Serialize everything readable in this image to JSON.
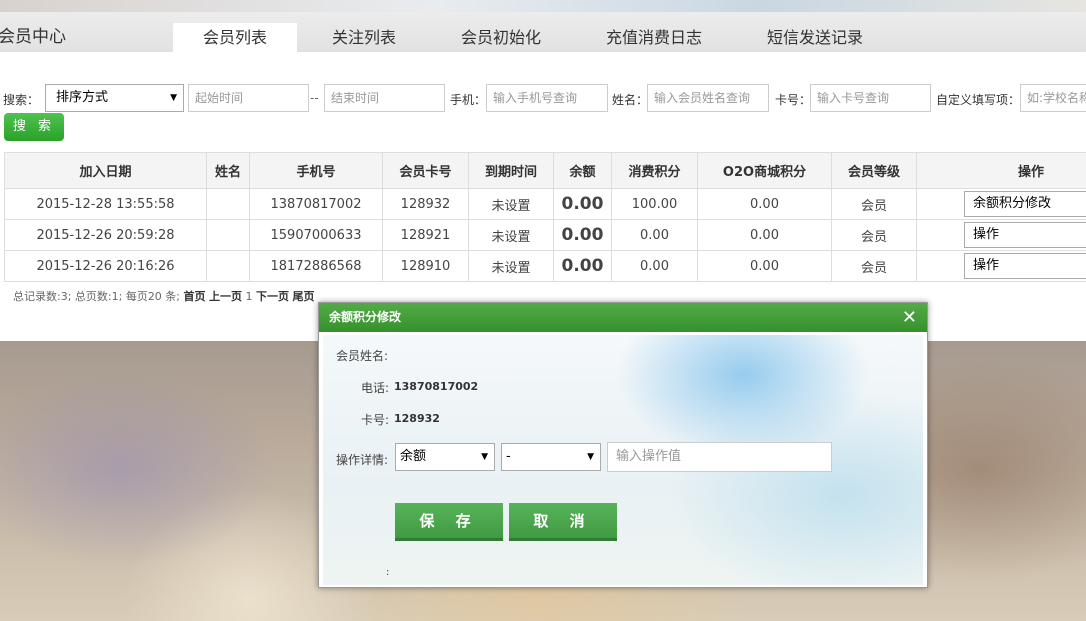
{
  "header": {
    "title": "会员中心",
    "tabs": [
      {
        "label": "会员列表",
        "active": true
      },
      {
        "label": "关注列表",
        "active": false
      },
      {
        "label": "会员初始化",
        "active": false
      },
      {
        "label": "充值消费日志",
        "active": false
      },
      {
        "label": "短信发送记录",
        "active": false
      }
    ]
  },
  "search": {
    "label": "搜索：",
    "sort_value": "排序方式",
    "start_placeholder": "起始时间",
    "separator": "--",
    "end_placeholder": "结束时间",
    "phone_label": "手机：",
    "phone_placeholder": "输入手机号查询",
    "name_label": "姓名：",
    "name_placeholder": "输入会员姓名查询",
    "card_label": "卡号：",
    "card_placeholder": "输入卡号查询",
    "custom_label": "自定义填写项：",
    "custom_placeholder": "如:学校名称",
    "button": "搜 索"
  },
  "table": {
    "columns": [
      "加入日期",
      "姓名",
      "手机号",
      "会员卡号",
      "到期时间",
      "余额",
      "消费积分",
      "O2O商城积分",
      "会员等级",
      "操作"
    ],
    "rows": [
      {
        "date": "2015-12-28 13:55:58",
        "name": "",
        "phone": "13870817002",
        "card": "128932",
        "expire": "未设置",
        "balance": "0.00",
        "points": "100.00",
        "o2o": "0.00",
        "level": "会员",
        "action": "余额积分修改"
      },
      {
        "date": "2015-12-26 20:59:28",
        "name": "",
        "phone": "15907000633",
        "card": "128921",
        "expire": "未设置",
        "balance": "0.00",
        "points": "0.00",
        "o2o": "0.00",
        "level": "会员",
        "action": "操作"
      },
      {
        "date": "2015-12-26 20:16:26",
        "name": "",
        "phone": "18172886568",
        "card": "128910",
        "expire": "未设置",
        "balance": "0.00",
        "points": "0.00",
        "o2o": "0.00",
        "level": "会员",
        "action": "操作"
      }
    ]
  },
  "pager": {
    "summary": "总记录数:3; 总页数:1; 每页20 条;",
    "first": "首页",
    "prev": "上一页",
    "current": "1",
    "next": "下一页",
    "last": "尾页"
  },
  "modal": {
    "title": "余额积分修改",
    "close": "✕",
    "name_label": "会员姓名:",
    "phone_label": "电话:",
    "phone_value": "13870817002",
    "card_label": "卡号:",
    "card_value": "128932",
    "detail_label": "操作详情:",
    "type_value": "余额",
    "op_value": "-",
    "value_placeholder": "输入操作值",
    "save": "保 存",
    "cancel": "取 消",
    "footer_text": ":"
  },
  "colors": {
    "accent_green": "#3f9a42",
    "link_blue": "#1a7abf",
    "balance_orange": "#ff6600"
  }
}
